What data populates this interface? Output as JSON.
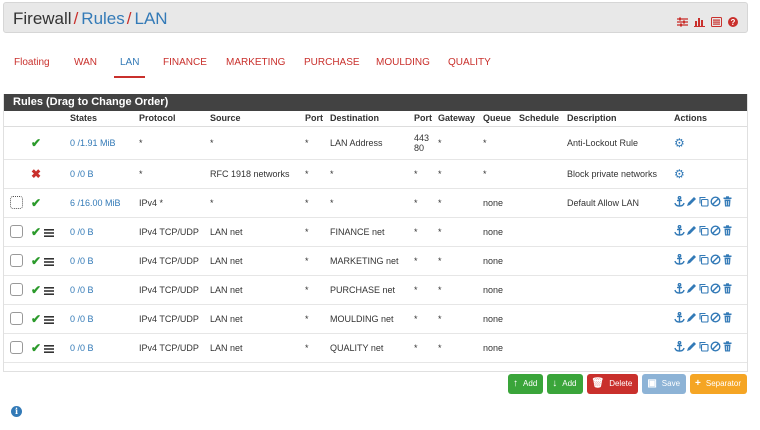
{
  "breadcrumb": {
    "firewall": "Firewall",
    "rules": "Rules",
    "current": "LAN",
    "sep": "/"
  },
  "header_icons": [
    "sliders-icon",
    "bar-chart-icon",
    "list-icon",
    "help-icon"
  ],
  "tabs": [
    "Floating",
    "WAN",
    "LAN",
    "FINANCE",
    "MARKETING",
    "PURCHASE",
    "MOULDING",
    "QUALITY"
  ],
  "active_tab": "LAN",
  "panel_title": "Rules (Drag to Change Order)",
  "columns": [
    "",
    "",
    "States",
    "Protocol",
    "Source",
    "Port",
    "Destination",
    "Port",
    "Gateway",
    "Queue",
    "Schedule",
    "Description",
    "Actions"
  ],
  "rows": [
    {
      "status": "pass",
      "states": "0 /1.91 MiB",
      "protocol": "*",
      "source": "*",
      "sport": "*",
      "destination": "LAN Address",
      "dport": "443\n80",
      "gateway": "*",
      "queue": "*",
      "schedule": "",
      "description": "Anti-Lockout Rule",
      "actions": "gear"
    },
    {
      "status": "block",
      "states": "0 /0 B",
      "protocol": "*",
      "source": "RFC 1918 networks",
      "sport": "*",
      "destination": "*",
      "dport": "*",
      "gateway": "*",
      "queue": "*",
      "schedule": "",
      "description": "Block private networks",
      "actions": "gear"
    },
    {
      "status": "pass",
      "states": "6 /16.00 MiB",
      "protocol": "IPv4 *",
      "source": "*",
      "sport": "*",
      "destination": "*",
      "dport": "*",
      "gateway": "*",
      "queue": "none",
      "schedule": "",
      "description": "Default Allow LAN",
      "actions": "full"
    },
    {
      "status": "pass",
      "states": "0 /0 B",
      "protocol": "IPv4 TCP/UDP",
      "source": "LAN net",
      "sport": "*",
      "destination": "FINANCE net",
      "dport": "*",
      "gateway": "*",
      "queue": "none",
      "schedule": "",
      "description": "",
      "actions": "full"
    },
    {
      "status": "pass",
      "states": "0 /0 B",
      "protocol": "IPv4 TCP/UDP",
      "source": "LAN net",
      "sport": "*",
      "destination": "MARKETING net",
      "dport": "*",
      "gateway": "*",
      "queue": "none",
      "schedule": "",
      "description": "",
      "actions": "full"
    },
    {
      "status": "pass",
      "states": "0 /0 B",
      "protocol": "IPv4 TCP/UDP",
      "source": "LAN net",
      "sport": "*",
      "destination": "PURCHASE net",
      "dport": "*",
      "gateway": "*",
      "queue": "none",
      "schedule": "",
      "description": "",
      "actions": "full"
    },
    {
      "status": "pass",
      "states": "0 /0 B",
      "protocol": "IPv4 TCP/UDP",
      "source": "LAN net",
      "sport": "*",
      "destination": "MOULDING net",
      "dport": "*",
      "gateway": "*",
      "queue": "none",
      "schedule": "",
      "description": "",
      "actions": "full"
    },
    {
      "status": "pass",
      "states": "0 /0 B",
      "protocol": "IPv4 TCP/UDP",
      "source": "LAN net",
      "sport": "*",
      "destination": "QUALITY net",
      "dport": "*",
      "gateway": "*",
      "queue": "none",
      "schedule": "",
      "description": "",
      "actions": "full"
    }
  ],
  "buttons": {
    "add_top": "Add",
    "add_bottom": "Add",
    "delete": "Delete",
    "save": "Save",
    "separator": "Separator"
  },
  "colors": {
    "accent_red": "#c9302c",
    "link_blue": "#337ab7",
    "pass_green": "#2b9a2b",
    "header_dark": "#424242"
  }
}
